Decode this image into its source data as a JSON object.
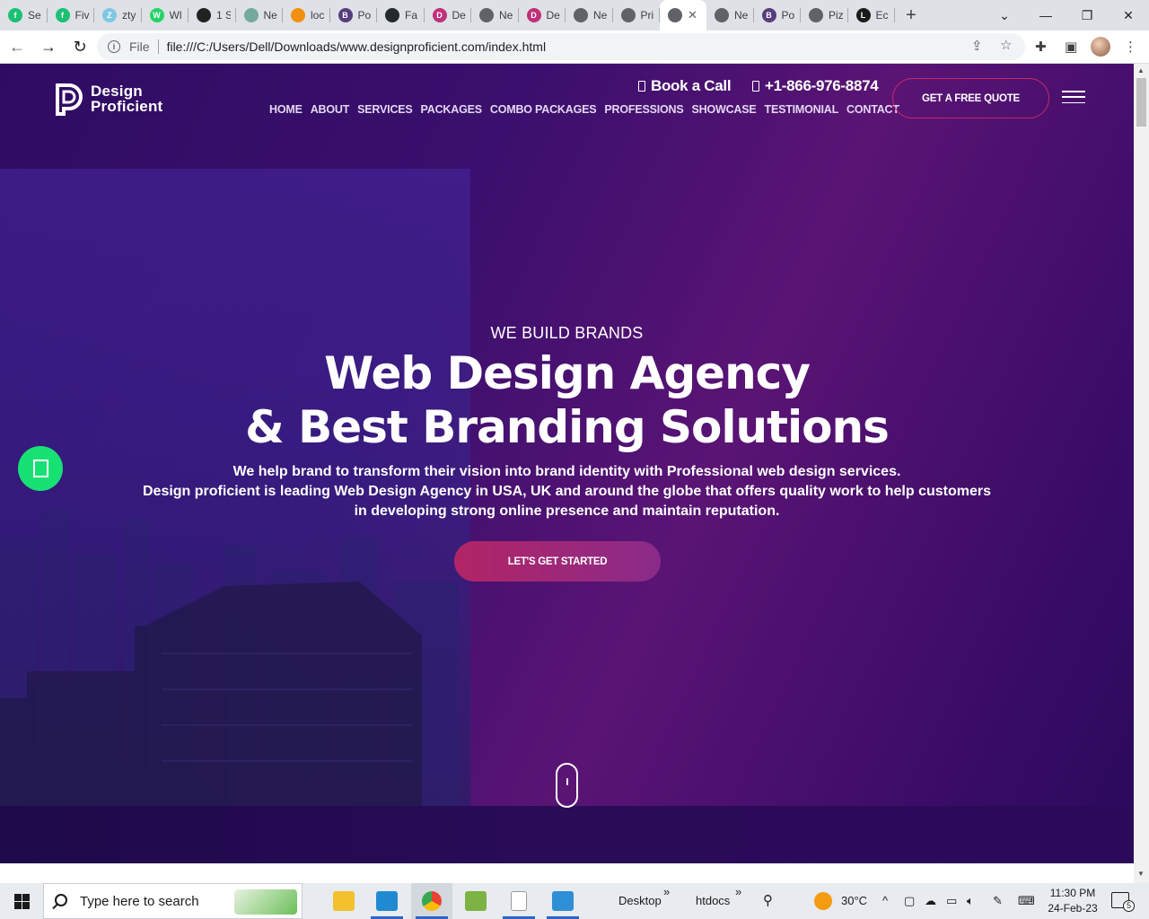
{
  "browser": {
    "tabs": [
      {
        "title": "Se",
        "favicon": "fiverr-icon",
        "color": "#1dbf73"
      },
      {
        "title": "Fiv",
        "favicon": "fiverr-icon",
        "color": "#1dbf73"
      },
      {
        "title": "zty",
        "favicon": "zety-icon",
        "color": "#7ec8e3"
      },
      {
        "title": "Wl",
        "favicon": "whatsapp-icon",
        "color": "#25d366"
      },
      {
        "title": "1 S",
        "favicon": "eye-icon",
        "color": "#222222"
      },
      {
        "title": "Ne",
        "favicon": "chatgpt-icon",
        "color": "#74aa9c"
      },
      {
        "title": "loc",
        "favicon": "phpmyadmin-icon",
        "color": "#f29111"
      },
      {
        "title": "Po",
        "favicon": "bootstrap-icon",
        "color": "#563d7c"
      },
      {
        "title": "Fa",
        "favicon": "github-icon",
        "color": "#24292e"
      },
      {
        "title": "De",
        "favicon": "designproficient-icon",
        "color": "#c0307a"
      },
      {
        "title": "Ne",
        "favicon": "globe-icon",
        "color": "#5f6368"
      },
      {
        "title": "De",
        "favicon": "designproficient-icon",
        "color": "#c0307a"
      },
      {
        "title": "Ne",
        "favicon": "globe-icon",
        "color": "#5f6368"
      },
      {
        "title": "Pri",
        "favicon": "globe-icon",
        "color": "#5f6368"
      },
      {
        "title": "",
        "favicon": "globe-icon",
        "color": "#5f6368",
        "active": true
      },
      {
        "title": "Ne",
        "favicon": "globe-icon",
        "color": "#5f6368"
      },
      {
        "title": "Po",
        "favicon": "bootstrap-icon",
        "color": "#563d7c"
      },
      {
        "title": "Piz",
        "favicon": "globe-icon",
        "color": "#5f6368"
      },
      {
        "title": "Ec",
        "favicon": "letter-l-icon",
        "color": "#1a1a1a"
      }
    ],
    "tab_fav_letters": [
      "f",
      "f",
      "Z",
      "W",
      "",
      "",
      "",
      "B",
      "",
      "D",
      "",
      "D",
      "",
      "",
      "",
      "",
      "B",
      "",
      "L"
    ],
    "address": {
      "scheme": "File",
      "url": "file:///C:/Users/Dell/Downloads/www.designproficient.com/index.html"
    }
  },
  "site": {
    "logo": {
      "line1": "Design",
      "line2": "Proficient"
    },
    "book_call": "Book a Call",
    "phone": "+1-866-976-8874",
    "nav": [
      "HOME",
      "ABOUT",
      "SERVICES",
      "PACKAGES",
      "COMBO PACKAGES",
      "PROFESSIONS",
      "SHOWCASE",
      "TESTIMONIAL",
      "CONTACT"
    ],
    "quote_button": "GET A FREE QUOTE",
    "hero": {
      "kicker": "WE BUILD BRANDS",
      "title_line1": "Web Design Agency",
      "title_line2": "& Best Branding Solutions",
      "desc_line1": "We help brand to transform their vision into brand identity with Professional web design services.",
      "desc_line2": "Design proficient is leading Web Design Agency in USA, UK and around the globe that offers quality work to help customers",
      "desc_line3": "in developing strong online presence and maintain reputation.",
      "cta": "LET'S GET STARTED"
    },
    "colors": {
      "accent": "#c4286a",
      "chat": "#18e174",
      "background": "#3a0f6d"
    }
  },
  "taskbar": {
    "search_placeholder": "Type here to search",
    "toolbar_desktop": "Desktop",
    "toolbar_htdocs": "htdocs",
    "weather": "30°C",
    "time": "11:30 PM",
    "date": "24-Feb-23",
    "notifications": "5"
  }
}
